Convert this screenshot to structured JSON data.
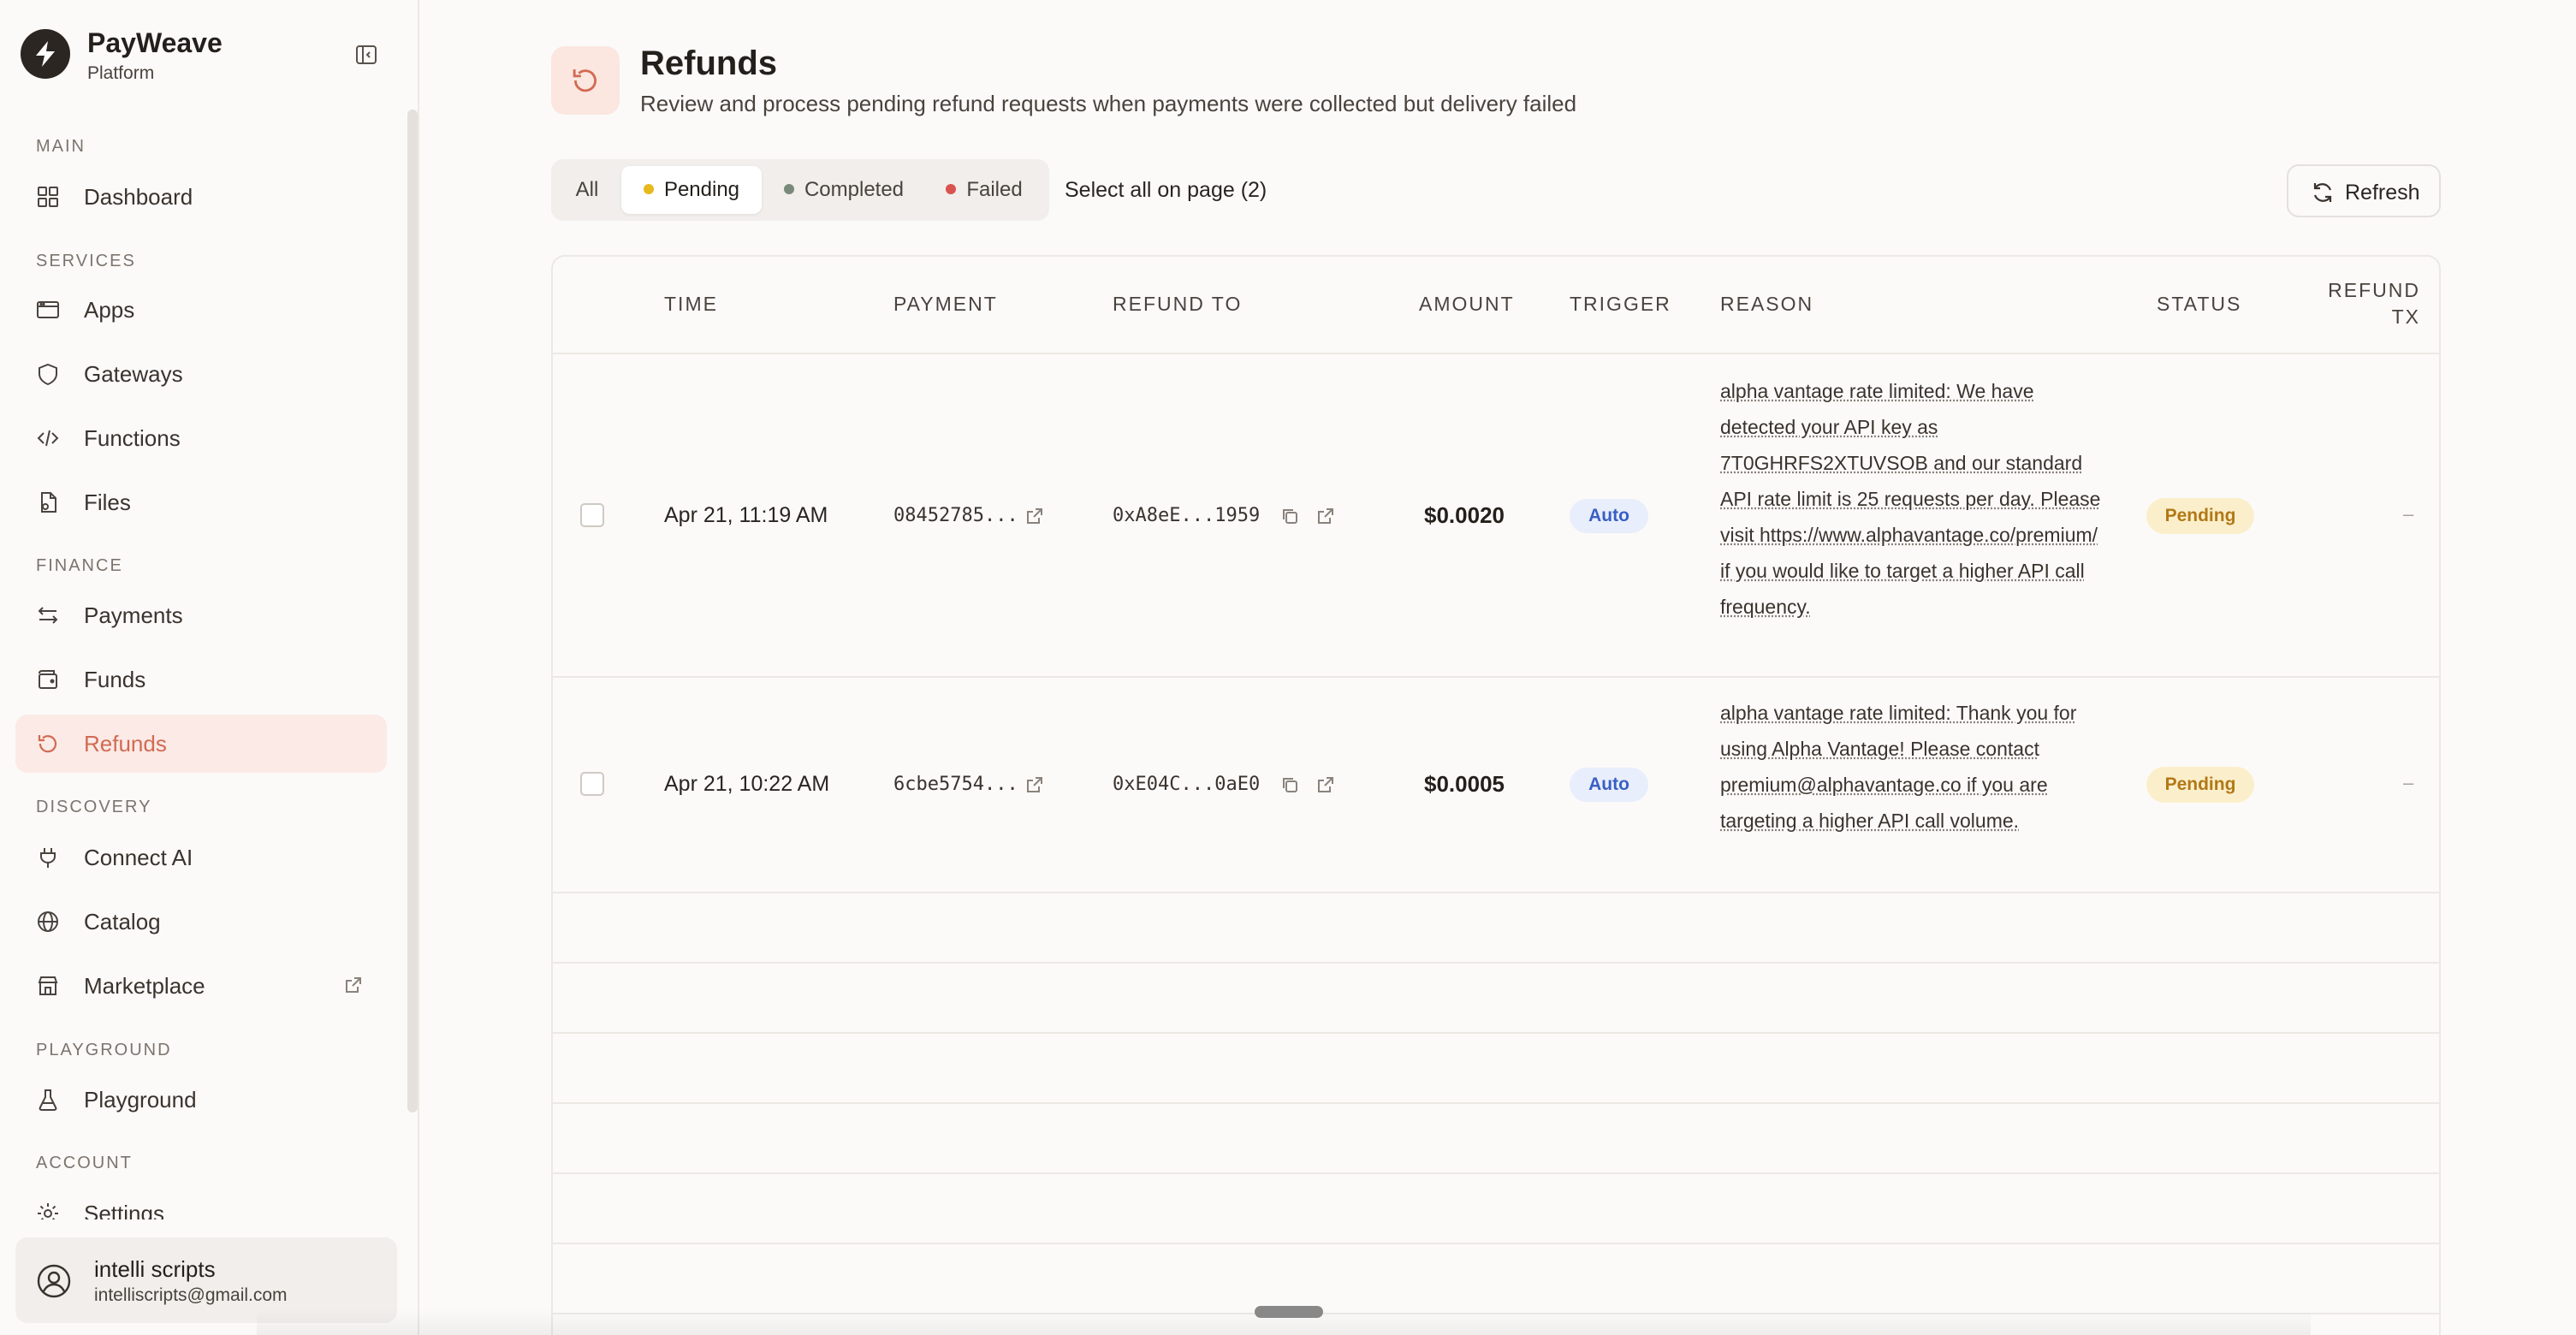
{
  "brand": {
    "name": "PayWeave",
    "subtitle": "Platform"
  },
  "nav": {
    "sections": {
      "main": "MAIN",
      "services": "SERVICES",
      "finance": "FINANCE",
      "discovery": "DISCOVERY",
      "playground": "PLAYGROUND",
      "account": "ACCOUNT"
    },
    "items": {
      "dashboard": "Dashboard",
      "apps": "Apps",
      "gateways": "Gateways",
      "functions": "Functions",
      "files": "Files",
      "payments": "Payments",
      "funds": "Funds",
      "refunds": "Refunds",
      "connect_ai": "Connect AI",
      "catalog": "Catalog",
      "marketplace": "Marketplace",
      "playground": "Playground",
      "settings": "Settings"
    }
  },
  "user": {
    "name": "intelli scripts",
    "email": "intelliscripts@gmail.com"
  },
  "page": {
    "title": "Refunds",
    "subtitle": "Review and process pending refund requests when payments were collected but delivery failed"
  },
  "filters": {
    "all": "All",
    "pending": "Pending",
    "completed": "Completed",
    "failed": "Failed",
    "select_all": "Select all on page (2)",
    "refresh": "Refresh"
  },
  "table": {
    "headers": {
      "time": "TIME",
      "payment": "PAYMENT",
      "refund_to": "REFUND TO",
      "amount": "AMOUNT",
      "trigger": "TRIGGER",
      "reason": "REASON",
      "status": "STATUS",
      "refund_tx_1": "REFUND",
      "refund_tx_2": "TX"
    },
    "rows": [
      {
        "time": "Apr 21, 11:19 AM",
        "payment": "08452785...",
        "refund_to": "0xA8eE...1959",
        "amount": "$0.0020",
        "trigger": "Auto",
        "reason": "alpha vantage rate limited: We have detected your API key as 7T0GHRFS2XTUVSOB and our standard API rate limit is 25 requests per day. Please visit https://www.alphavantage.co/premium/ if you would like to target a higher API call frequency.",
        "status": "Pending",
        "refund_tx": "–"
      },
      {
        "time": "Apr 21, 10:22 AM",
        "payment": "6cbe5754...",
        "refund_to": "0xE04C...0aE0",
        "amount": "$0.0005",
        "trigger": "Auto",
        "reason": "alpha vantage rate limited: Thank you for using Alpha Vantage! Please contact premium@alphavantage.co if you are targeting a higher API call volume.",
        "status": "Pending",
        "refund_tx": "–"
      }
    ]
  },
  "colors": {
    "accent": "#d26a52",
    "active_bg": "#fbeae6",
    "pending_dot": "#e8b91c",
    "completed_dot": "#7a8a7a",
    "failed_dot": "#d9534f",
    "auto_badge": "#3a5fc4",
    "pending_badge": "#b27816"
  }
}
